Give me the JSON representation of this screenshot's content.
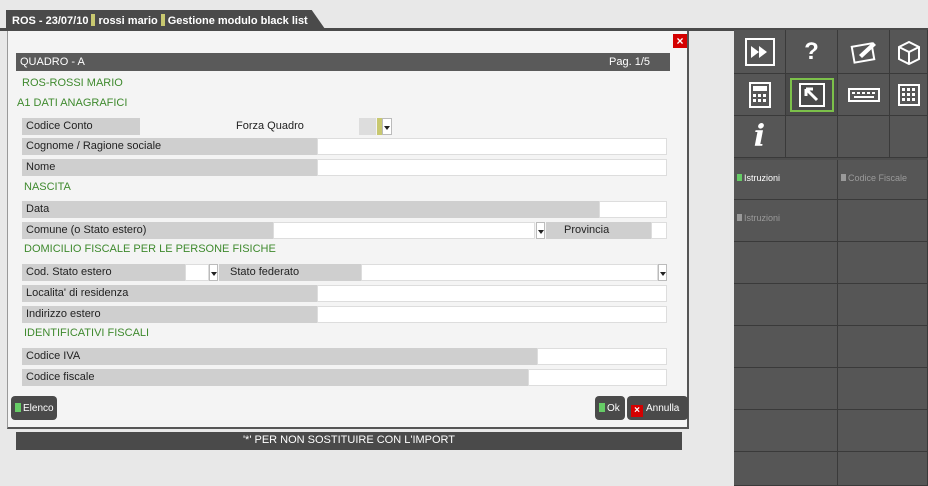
{
  "window": {
    "ros": "ROS - 23/07/10",
    "user": "rossi mario",
    "title": "Gestione modulo black list"
  },
  "dialog": {
    "close_icon": "close-icon",
    "quadro": "QUADRO - A",
    "page": "Pag. 1/5",
    "company": "ROS-ROSSI MARIO",
    "section_a1": "A1   DATI ANAGRAFICI",
    "codice_conto": "Codice Conto",
    "forza_quadro": "Forza Quadro",
    "cognome": "Cognome / Ragione sociale",
    "nome": "Nome",
    "section_nascita": "NASCITA",
    "data": "Data",
    "comune": "Comune (o Stato estero)",
    "provincia": "Provincia",
    "section_domicilio": "DOMICILIO FISCALE PER LE PERSONE FISICHE",
    "cod_stato": "Cod. Stato estero",
    "stato_federato": "Stato federato",
    "localita": "Localita' di residenza",
    "indirizzo": "Indirizzo estero",
    "section_ident": "IDENTIFICATIVI FISCALI",
    "codice_iva": "Codice IVA",
    "codice_fiscale": "Codice fiscale",
    "btn_elenco": "Elenco",
    "btn_ok": "Ok",
    "btn_annulla": "Annulla",
    "footer": "'*' PER NON SOSTITUIRE CON L'IMPORT"
  },
  "panel": {
    "icons": [
      "fast-forward-icon",
      "help-icon",
      "edit-icon",
      "package-icon",
      "calculator-icon",
      "select-icon",
      "keyboard-icon",
      "grid-icon",
      "info-icon"
    ],
    "istruzioni": "Istruzioni",
    "codice_fiscale": "Codice Fiscale",
    "istruzioni2": "Istruzioni"
  },
  "colors": {
    "accent_green": "#3f8a2e",
    "close_red": "#d40000",
    "dark_gray": "#4a4a4a"
  }
}
